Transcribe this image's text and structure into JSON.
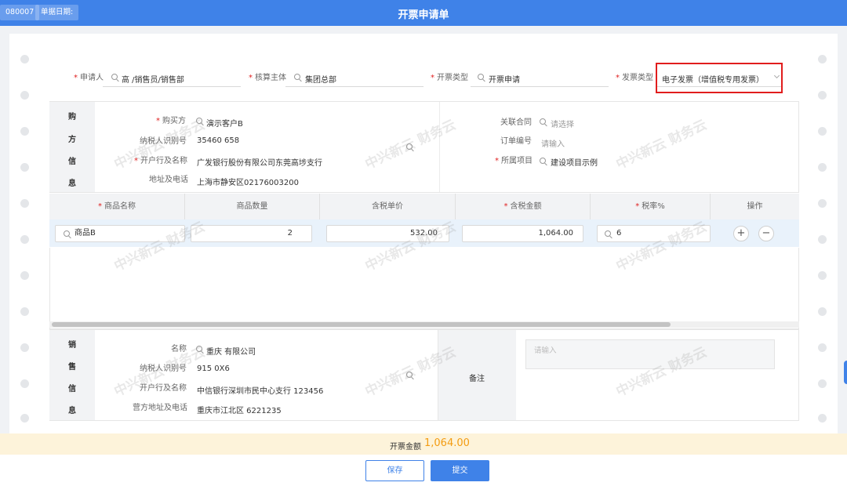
{
  "topbar": {
    "doc_no": "080007",
    "doc_date_label": "单据日期:",
    "title": "开票申请单"
  },
  "header": {
    "applicant_label": "申请人",
    "applicant_value": "高 /销售员/销售部",
    "entity_label": "核算主体",
    "entity_value": "集团总部",
    "type_label": "开票类型",
    "type_value": "开票申请",
    "invoice_type_label": "发票类型",
    "invoice_type_value": "电子发票（增值税专用发票）"
  },
  "buyer": {
    "side_title": [
      "购",
      "方",
      "信",
      "息"
    ],
    "name_label": "购买方",
    "name_value": "演示客户B",
    "tax_label": "纳税人识别号",
    "tax_value": "35460          658",
    "bank_label": "开户行及名称",
    "bank_value": "广发银行股份有限公司东莞高埗支行",
    "addr_label": "地址及电话",
    "addr_value": "上海市静安区02176003200",
    "contract_label": "关联合同",
    "contract_placeholder": "请选择",
    "order_label": "订单编号",
    "order_placeholder": "请输入",
    "project_label": "所属项目",
    "project_value": "建设项目示例"
  },
  "items_table": {
    "headers": [
      "商品名称",
      "商品数量",
      "含税单价",
      "含税金额",
      "税率%",
      "操作"
    ],
    "rows": [
      {
        "name": "商品B",
        "qty": "2",
        "price": "532.00",
        "amount": "1,064.00",
        "rate": "6"
      }
    ],
    "add_icon": "+",
    "remove_icon": "−"
  },
  "seller": {
    "side_title": [
      "销",
      "售",
      "信",
      "息"
    ],
    "name_label": "名称",
    "name_value": "重庆         有限公司",
    "tax_label": "纳税人识别号",
    "tax_value": "915         0X6",
    "bank_label": "开户行及名称",
    "bank_value": "中信银行深圳市民中心支行 123456",
    "addr_label": "营方地址及电话",
    "addr_value": "重庆市江北区 6221235",
    "remark_label": "备注",
    "remark_placeholder": "请输入"
  },
  "watermark": "中兴新云 财务云",
  "footer": {
    "amount_label": "开票金额",
    "amount_value": "1,064.00",
    "save_label": "保存",
    "submit_label": "提交"
  },
  "colors": {
    "primary": "#3f82e8",
    "highlight": "#e11d1d",
    "amount": "#f39c12"
  }
}
